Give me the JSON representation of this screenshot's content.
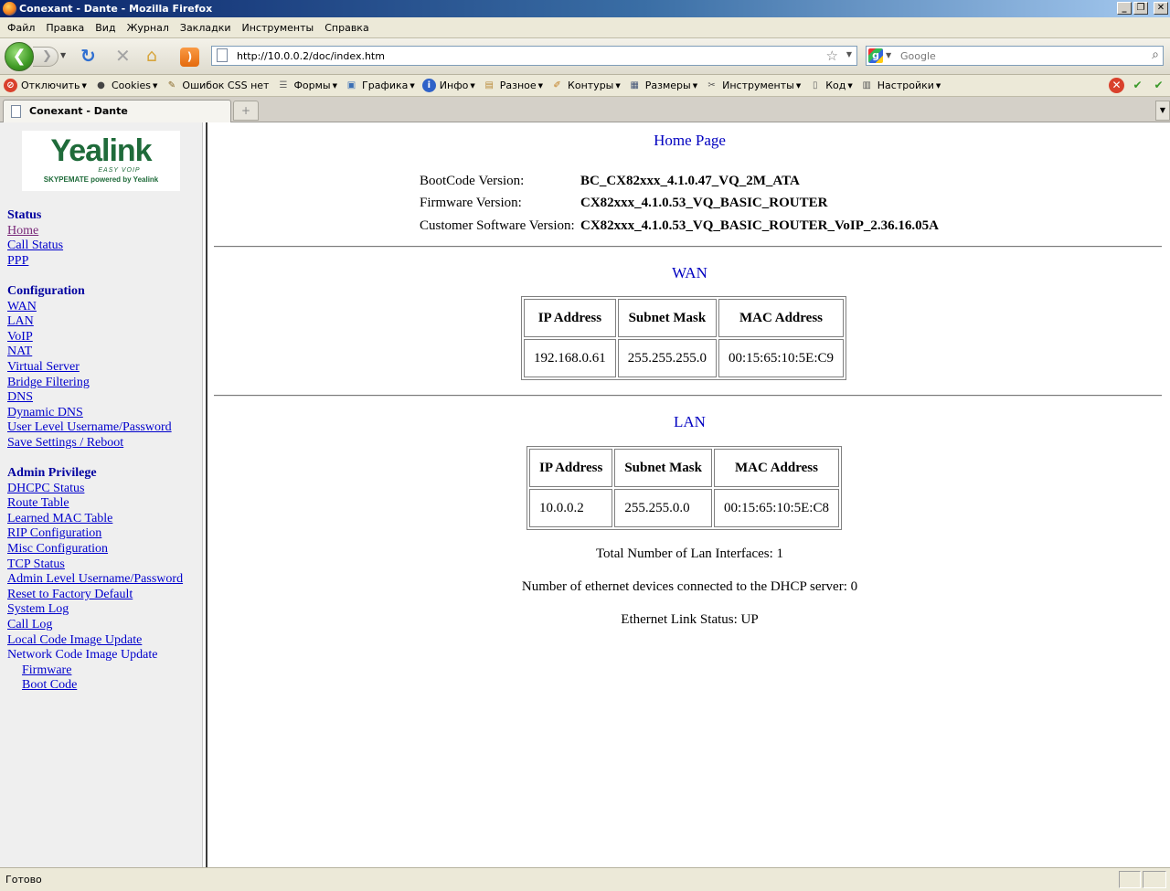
{
  "window": {
    "title": "Conexant - Dante - Mozilla Firefox",
    "buttons": [
      "_",
      "❐",
      "✕"
    ]
  },
  "menu": [
    "Файл",
    "Правка",
    "Вид",
    "Журнал",
    "Закладки",
    "Инструменты",
    "Справка"
  ],
  "navbar": {
    "url": "http://10.0.0.2/doc/index.htm",
    "search_placeholder": "Google"
  },
  "devbar": {
    "items": [
      {
        "label": "Отключить",
        "icon": "disable-icon",
        "color": "#d9412c"
      },
      {
        "label": "Cookies",
        "icon": "cookie-icon",
        "color": "#444444"
      },
      {
        "label": "Ошибок CSS нет",
        "icon": "css-icon",
        "color": "#8a6a2a"
      },
      {
        "label": "Формы",
        "icon": "forms-icon",
        "color": "#666666"
      },
      {
        "label": "Графика",
        "icon": "images-icon",
        "color": "#3b6fb4"
      },
      {
        "label": "Инфо",
        "icon": "info-icon",
        "color": "#2f62c8"
      },
      {
        "label": "Разное",
        "icon": "misc-icon",
        "color": "#b98a3a"
      },
      {
        "label": "Контуры",
        "icon": "outline-icon",
        "color": "#c07a1a"
      },
      {
        "label": "Размеры",
        "icon": "resize-icon",
        "color": "#445577"
      },
      {
        "label": "Инструменты",
        "icon": "tools-icon",
        "color": "#555555"
      },
      {
        "label": "Код",
        "icon": "source-icon",
        "color": "#666666"
      },
      {
        "label": "Настройки",
        "icon": "options-icon",
        "color": "#555555"
      }
    ]
  },
  "tab": {
    "label": "Conexant - Dante"
  },
  "sidebar": {
    "logo": {
      "brand": "Yealink",
      "tagline": "EASY VOIP",
      "sub": "SKYPEMATE powered by Yealink"
    },
    "status": {
      "heading": "Status",
      "links": [
        "Home",
        "Call Status",
        "PPP"
      ]
    },
    "configuration": {
      "heading": "Configuration",
      "links": [
        "WAN",
        "LAN",
        "VoIP",
        "NAT",
        "Virtual Server",
        "Bridge Filtering",
        "DNS",
        "Dynamic DNS",
        "User Level Username/Password",
        "Save Settings / Reboot"
      ]
    },
    "admin": {
      "heading": "Admin Privilege",
      "links": [
        "DHCPC Status",
        "Route Table",
        "Learned MAC Table",
        "RIP Configuration",
        "Misc Configuration",
        "TCP Status",
        "Admin Level Username/Password",
        "Reset to Factory Default",
        "System Log",
        "Call Log",
        "Local Code Image Update"
      ],
      "network_update": "Network Code Image Update",
      "sub_links": [
        "Firmware",
        "Boot Code"
      ]
    }
  },
  "main": {
    "title": "Home Page",
    "versions": [
      {
        "label": "BootCode Version:",
        "value": "BC_CX82xxx_4.1.0.47_VQ_2M_ATA"
      },
      {
        "label": "Firmware Version:",
        "value": "CX82xxx_4.1.0.53_VQ_BASIC_ROUTER"
      },
      {
        "label": "Customer Software Version:",
        "value": "CX82xxx_4.1.0.53_VQ_BASIC_ROUTER_VoIP_2.36.16.05A"
      }
    ],
    "wan": {
      "title": "WAN",
      "headers": [
        "IP Address",
        "Subnet Mask",
        "MAC Address"
      ],
      "row": [
        "192.168.0.61",
        "255.255.255.0",
        "00:15:65:10:5E:C9"
      ]
    },
    "lan": {
      "title": "LAN",
      "headers": [
        "IP Address",
        "Subnet Mask",
        "MAC Address"
      ],
      "row": [
        "10.0.0.2",
        "255.255.0.0",
        "00:15:65:10:5E:C8"
      ]
    },
    "total_lan": "Total Number of Lan Interfaces: 1",
    "dhcp_devices": "Number of ethernet devices connected to the DHCP server: 0",
    "link_status": "Ethernet Link Status: UP"
  },
  "statusbar": {
    "text": "Готово"
  }
}
